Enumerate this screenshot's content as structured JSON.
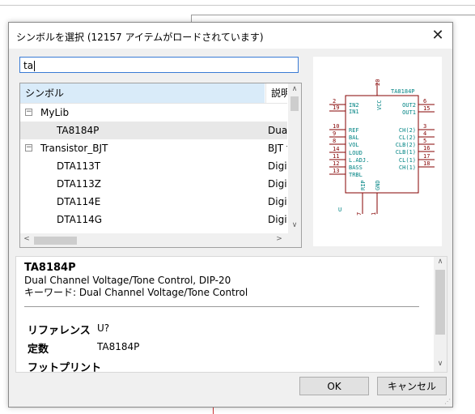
{
  "window": {
    "title": "シンボルを選択 (12157 アイテムがロードされています)",
    "close_glyph": "✕"
  },
  "search": {
    "value": "ta"
  },
  "tree": {
    "columns": [
      "シンボル",
      "説明"
    ],
    "rows": [
      {
        "type": "group",
        "expander": "−",
        "name": "MyLib",
        "desc": ""
      },
      {
        "type": "item",
        "name": "TA8184P",
        "desc": "Dual",
        "selected": true
      },
      {
        "type": "group",
        "expander": "−",
        "name": "Transistor_BJT",
        "desc": "BJT t"
      },
      {
        "type": "item",
        "name": "DTA113T",
        "desc": "Digit"
      },
      {
        "type": "item",
        "name": "DTA113Z",
        "desc": "Digit"
      },
      {
        "type": "item",
        "name": "DTA114E",
        "desc": "Digit"
      },
      {
        "type": "item",
        "name": "DTA114G",
        "desc": "Digit"
      }
    ],
    "scroll_up": "∧",
    "scroll_down": "∨",
    "scroll_left": "<",
    "scroll_right": ">"
  },
  "symbol_preview": {
    "part": "TA8184P",
    "ref": "U",
    "left_pins": [
      {
        "num": "2",
        "name": "IN2"
      },
      {
        "num": "19",
        "name": "IN1"
      },
      {
        "num": "10",
        "name": "REF"
      },
      {
        "num": "9",
        "name": "BAL"
      },
      {
        "num": "8",
        "name": "VOL"
      },
      {
        "num": "14",
        "name": "LOUD"
      },
      {
        "num": "11",
        "name": "L.ADJ."
      },
      {
        "num": "12",
        "name": "BASS"
      },
      {
        "num": "13",
        "name": "TRBL"
      }
    ],
    "right_pins": [
      {
        "num": "6",
        "name": "OUT2"
      },
      {
        "num": "15",
        "name": "OUT1"
      },
      {
        "num": "3",
        "name": "CH(2)"
      },
      {
        "num": "4",
        "name": "CL(2)"
      },
      {
        "num": "5",
        "name": "CLB(2)"
      },
      {
        "num": "16",
        "name": "CLB(1)"
      },
      {
        "num": "17",
        "name": "CL(1)"
      },
      {
        "num": "18",
        "name": "CH(1)"
      }
    ],
    "top_pin": {
      "num": "20",
      "name": "VCC"
    },
    "bottom_pins": [
      {
        "num": "7",
        "name": "RIP"
      },
      {
        "num": "1",
        "name": "GND"
      }
    ]
  },
  "details": {
    "name": "TA8184P",
    "description": "Dual Channel Voltage/Tone Control, DIP-20",
    "keywords": "キーワード: Dual Channel Voltage/Tone Control",
    "fields": [
      {
        "label": "リファレンス",
        "value": "U?"
      },
      {
        "label": "定数",
        "value": "TA8184P"
      },
      {
        "label": "フットプリント",
        "value": ""
      }
    ],
    "scroll_up": "∧",
    "scroll_down": "∨"
  },
  "buttons": {
    "ok": "OK",
    "cancel": "キャンセル"
  },
  "colors": {
    "symbol_body": "#840000",
    "pin_text": "#008484",
    "selection": "#d9ebf9"
  }
}
